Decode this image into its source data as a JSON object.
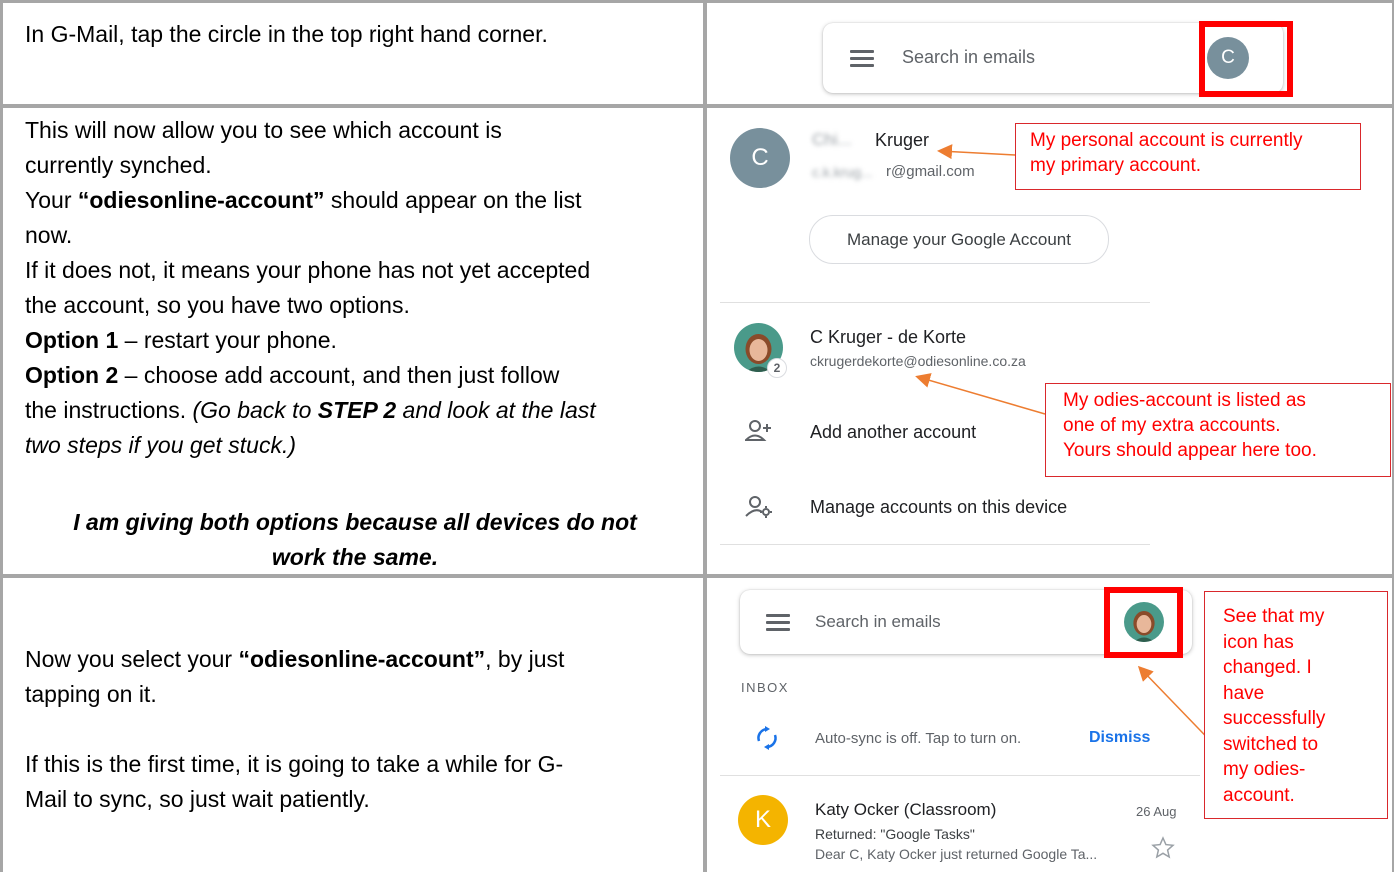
{
  "rows": [
    {
      "instruction": "In G-Mail, tap the circle in the top right hand corner.",
      "search_placeholder": "Search in emails",
      "avatar_letter": "C"
    },
    {
      "line1": "This will now allow you to see which account is",
      "line2": "currently synched.",
      "line3_pre": "Your ",
      "line3_bold": "“odiesonline-account”",
      "line3_post": " should appear on the list",
      "line4": "now.",
      "line5": "If it does not, it means your phone has not yet accepted",
      "line6": "the account, so you have two options.",
      "opt1_bold": "Option 1",
      "opt1_text": " – restart your phone.",
      "opt2_bold": "Option 2",
      "opt2_text": " – choose add account, and then just follow",
      "line9": "the instructions. ",
      "line9_italic_a": "(Go back to ",
      "line9_bold_italic": "STEP 2",
      "line9_italic_b": " and look at the last",
      "line10": "two steps if you get stuck.)",
      "note1": "I am giving both options because all devices do not",
      "note2": "work the same.",
      "primary": {
        "avatar_letter": "C",
        "name_visible": "Kruger",
        "name_blurred": "Chi...",
        "email_blurred": "c.k.krug...",
        "email_visible": "r@gmail.com",
        "manage_label": "Manage your Google Account"
      },
      "secondary": {
        "name": "C Kruger - de Korte",
        "email": "ckrugerdekorte@odiesonline.co.za",
        "badge": "2"
      },
      "add_account": "Add another account",
      "manage_device": "Manage accounts on this device",
      "callout_primary": [
        "My personal account is currently",
        "my primary account."
      ],
      "callout_secondary": [
        "My odies-account is listed as",
        "one of my extra accounts.",
        "Yours should appear here too."
      ]
    },
    {
      "para1_pre": "Now you select your ",
      "para1_bold": "“odiesonline-account”",
      "para1_post": ", by just",
      "para1_line2": "tapping on it.",
      "para2_line1": "If this is the first time, it is going to take a while for G-",
      "para2_line2": "Mail to sync, so just wait patiently.",
      "search_placeholder": "Search in emails",
      "inbox_label": "INBOX",
      "sync_text": "Auto-sync is off. Tap to turn on.",
      "dismiss": "Dismiss",
      "mail": {
        "avatar_letter": "K",
        "sender": "Katy Ocker (Classroom)",
        "date": "26 Aug",
        "subject": "Returned: \"Google Tasks\"",
        "preview": "Dear C, Katy Ocker just returned Google Ta..."
      },
      "callout": [
        "See that my",
        "icon has",
        "changed.  I",
        "have",
        "successfully",
        "switched to",
        "my odies-",
        "account."
      ]
    }
  ],
  "colors": {
    "red": "#ff0000",
    "avatar_grey": "#78909c",
    "avatar_orange": "#f4b400",
    "arrow_orange": "#ed7d31",
    "sync_blue": "#1a73e8",
    "grid": "#a6a6a6"
  }
}
